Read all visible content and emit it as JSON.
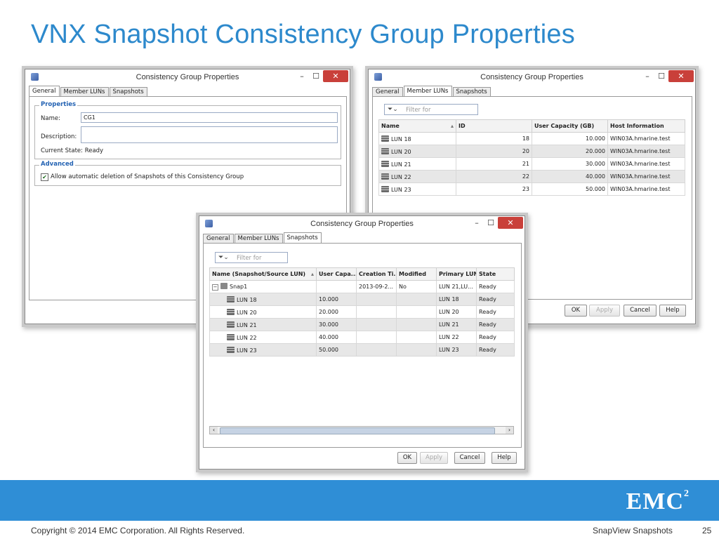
{
  "slide": {
    "title": "VNX Snapshot Consistency Group Properties",
    "copyright": "Copyright © 2014 EMC Corporation. All Rights Reserved.",
    "section": "SnapView Snapshots",
    "page_number": "25",
    "logo": "EMC",
    "logo_sup": "2"
  },
  "colors": {
    "title": "#2d89cc",
    "band": "#2f8ed6",
    "close_button": "#c9403a",
    "legend": "#2463b3"
  },
  "window_title": "Consistency Group Properties",
  "tabs": {
    "general": "General",
    "member_luns": "Member LUNs",
    "snapshots": "Snapshots"
  },
  "buttons": {
    "ok": "OK",
    "apply": "Apply",
    "cancel": "Cancel",
    "help": "Help"
  },
  "titlebar": {
    "minimize": "–",
    "maximize": "☐",
    "close": "✕"
  },
  "general": {
    "properties_legend": "Properties",
    "name_label": "Name:",
    "name_value": "CG1",
    "description_label": "Description:",
    "description_value": "",
    "current_state": "Current State: Ready",
    "advanced_legend": "Advanced",
    "auto_delete_label": "Allow automatic deletion of Snapshots of this Consistency Group",
    "auto_delete_checked": true
  },
  "member_luns": {
    "filter_placeholder": "Filter for",
    "columns": [
      "Name",
      "ID",
      "User Capacity (GB)",
      "Host Information"
    ],
    "rows": [
      {
        "name": "LUN 18",
        "id": "18",
        "capacity": "10.000",
        "host": "WIN03A.hmarine.test"
      },
      {
        "name": "LUN 20",
        "id": "20",
        "capacity": "20.000",
        "host": "WIN03A.hmarine.test"
      },
      {
        "name": "LUN 21",
        "id": "21",
        "capacity": "30.000",
        "host": "WIN03A.hmarine.test"
      },
      {
        "name": "LUN 22",
        "id": "22",
        "capacity": "40.000",
        "host": "WIN03A.hmarine.test"
      },
      {
        "name": "LUN 23",
        "id": "23",
        "capacity": "50.000",
        "host": "WIN03A.hmarine.test"
      }
    ]
  },
  "snapshots": {
    "filter_placeholder": "Filter for",
    "columns": [
      "Name (Snapshot/Source LUN)",
      "User Capa...",
      "Creation Ti...",
      "Modified",
      "Primary LUN",
      "State"
    ],
    "snap": {
      "name": "Snap1",
      "capacity": "",
      "created": "2013-09-2...",
      "modified": "No",
      "primary": "LUN 21,LU...",
      "state": "Ready"
    },
    "rows": [
      {
        "name": "LUN 18",
        "capacity": "10.000",
        "created": "",
        "modified": "",
        "primary": "LUN 18",
        "state": "Ready"
      },
      {
        "name": "LUN 20",
        "capacity": "20.000",
        "created": "",
        "modified": "",
        "primary": "LUN 20",
        "state": "Ready"
      },
      {
        "name": "LUN 21",
        "capacity": "30.000",
        "created": "",
        "modified": "",
        "primary": "LUN 21",
        "state": "Ready"
      },
      {
        "name": "LUN 22",
        "capacity": "40.000",
        "created": "",
        "modified": "",
        "primary": "LUN 22",
        "state": "Ready"
      },
      {
        "name": "LUN 23",
        "capacity": "50.000",
        "created": "",
        "modified": "",
        "primary": "LUN 23",
        "state": "Ready"
      }
    ]
  }
}
